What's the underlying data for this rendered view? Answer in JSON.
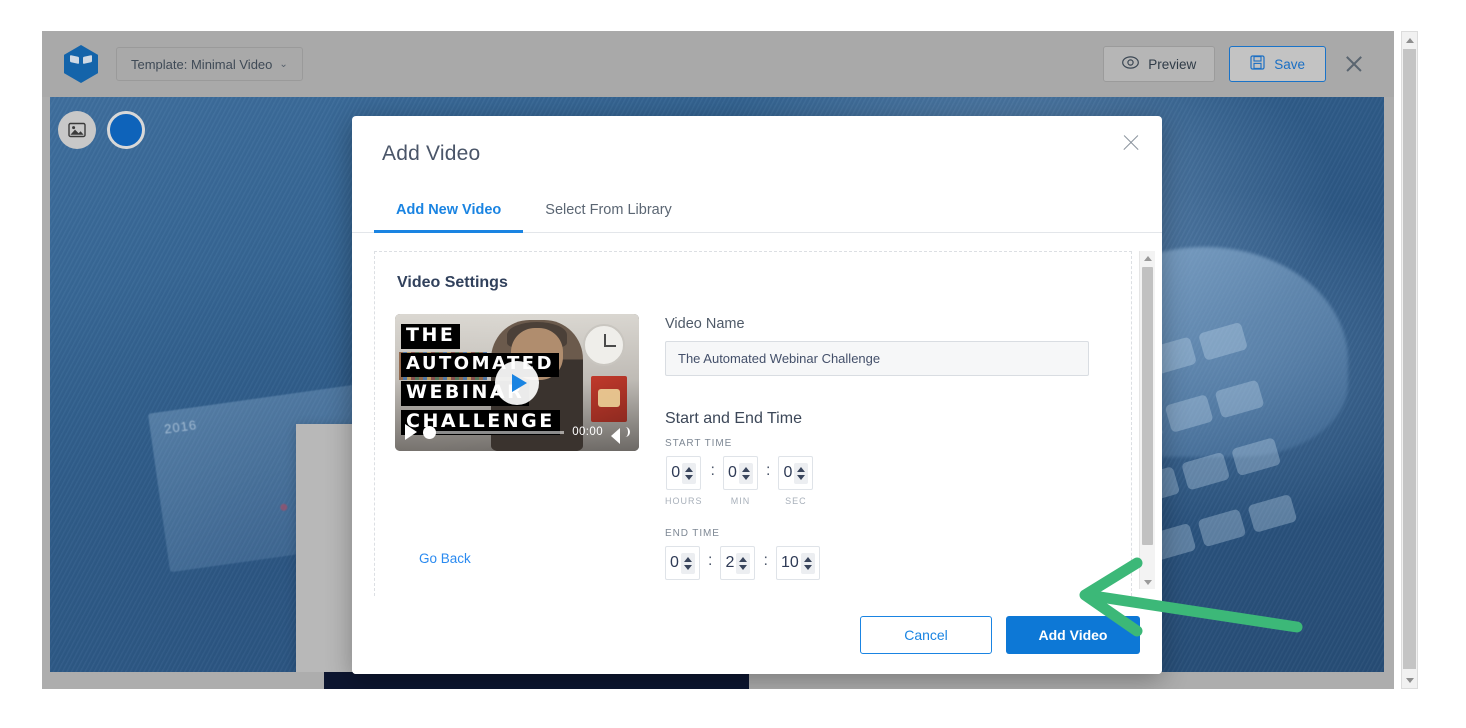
{
  "toolbar": {
    "template_label": "Template: Minimal Video",
    "caret": "⌄",
    "preview_label": "Preview",
    "save_label": "Save",
    "logo_name": "ninja-logo"
  },
  "canvas": {
    "image_tool_icon": "image-icon",
    "color_swatch": "#0e63ba",
    "calendar_year": "2016"
  },
  "modal": {
    "title": "Add Video",
    "tabs": [
      {
        "label": "Add New Video",
        "active": true
      },
      {
        "label": "Select From Library",
        "active": false
      }
    ],
    "section_title": "Video Settings",
    "video": {
      "overlay_lines": [
        "THE",
        "AUTOMATED",
        "WEBINAR",
        "CHALLENGE"
      ],
      "current_time": "00:00",
      "play_icon": "play-icon",
      "volume_icon": "volume-icon"
    },
    "name_field": {
      "label": "Video Name",
      "value": "The Automated Webinar Challenge",
      "placeholder": "Video Name"
    },
    "time": {
      "section_title": "Start and End Time",
      "start_caption": "START TIME",
      "end_caption": "END TIME",
      "start": {
        "hours": "0",
        "min": "0",
        "sec": "0"
      },
      "end": {
        "hours": "0",
        "min": "2",
        "sec": "10"
      },
      "units": {
        "hours": "HOURS",
        "min": "MIN",
        "sec": "SEC"
      },
      "separator": ":"
    },
    "go_back_label": "Go Back",
    "footer": {
      "cancel_label": "Cancel",
      "add_label": "Add Video"
    }
  },
  "annotation": {
    "color": "#3cb878",
    "name": "green-arrow-pointing-to-add-video"
  }
}
